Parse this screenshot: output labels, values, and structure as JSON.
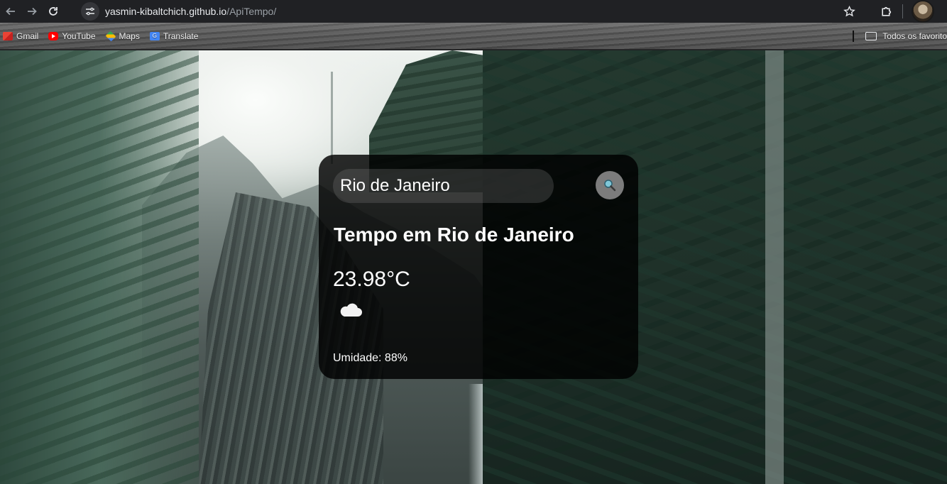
{
  "browser": {
    "url_host": "yasmin-kibaltchich.github.io",
    "url_path": "/ApiTempo/",
    "bookmarks": [
      {
        "label": "Gmail",
        "icon": "gmail-icon"
      },
      {
        "label": "YouTube",
        "icon": "youtube-icon"
      },
      {
        "label": "Maps",
        "icon": "maps-icon"
      },
      {
        "label": "Translate",
        "icon": "translate-icon"
      }
    ],
    "all_bookmarks_label": "Todos os favorito"
  },
  "weather": {
    "search_value": "Rio de Janeiro",
    "title": "Tempo em Rio de Janeiro",
    "temperature": "23.98°C",
    "condition_icon": "cloud-icon",
    "humidity": "Umidade: 88%"
  },
  "colors": {
    "card_background": "#000000",
    "search_button": "#7c7c7c",
    "text": "#ffffff"
  }
}
